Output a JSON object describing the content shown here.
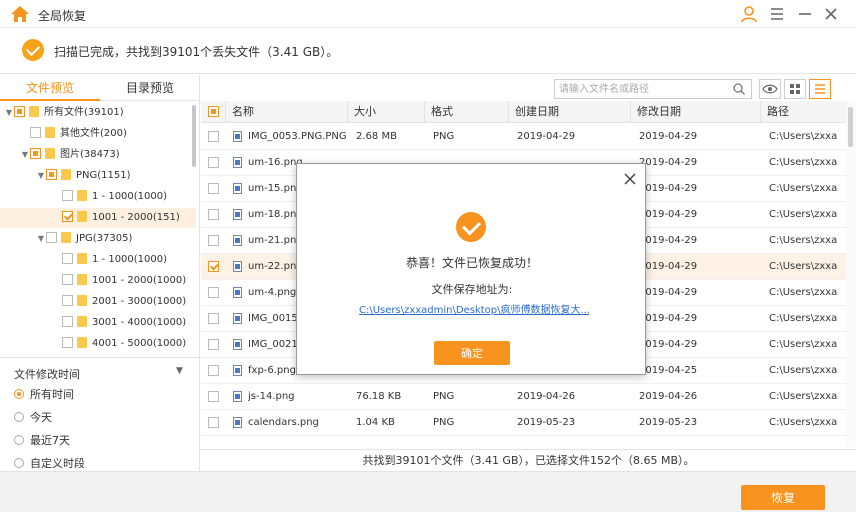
{
  "titlebar": {
    "title": "全局恢复"
  },
  "status": {
    "text": "扫描已完成，共找到39101个丢失文件（3.41 GB）。"
  },
  "sidebar": {
    "tabs": [
      {
        "label": "文件预览",
        "active": true
      },
      {
        "label": "目录预览",
        "active": false
      }
    ],
    "tree": [
      {
        "label": "所有文件(39101)"
      },
      {
        "label": "其他文件(200)"
      },
      {
        "label": "图片(38473)"
      },
      {
        "label": "PNG(1151)"
      },
      {
        "label": "1 - 1000(1000)"
      },
      {
        "label": "1001 - 2000(151)"
      },
      {
        "label": "JPG(37305)"
      },
      {
        "label": "1 - 1000(1000)"
      },
      {
        "label": "1001 - 2000(1000)"
      },
      {
        "label": "2001 - 3000(1000)"
      },
      {
        "label": "3001 - 4000(1000)"
      },
      {
        "label": "4001 - 5000(1000)"
      }
    ],
    "filter": {
      "title": "文件修改时间",
      "options": [
        {
          "label": "所有时间",
          "selected": true
        },
        {
          "label": "今天",
          "selected": false
        },
        {
          "label": "最近7天",
          "selected": false
        },
        {
          "label": "自定义时段",
          "selected": false
        }
      ]
    }
  },
  "toolbar": {
    "search_placeholder": "请输入文件名或路径"
  },
  "table": {
    "columns": [
      "名称",
      "大小",
      "格式",
      "创建日期",
      "修改日期",
      "路径"
    ],
    "rows": [
      {
        "name": "IMG_0053.PNG.PNG",
        "size": "2.68 MB",
        "format": "PNG",
        "created": "2019-04-29",
        "modified": "2019-04-29",
        "path": "C:\\Users\\zxxa",
        "checked": false
      },
      {
        "name": "um-16.png",
        "size": "",
        "format": "",
        "created": "",
        "modified": "2019-04-29",
        "path": "C:\\Users\\zxxa",
        "checked": false
      },
      {
        "name": "um-15.png",
        "size": "",
        "format": "",
        "created": "",
        "modified": "2019-04-29",
        "path": "C:\\Users\\zxxa",
        "checked": false
      },
      {
        "name": "um-18.png",
        "size": "",
        "format": "",
        "created": "",
        "modified": "2019-04-29",
        "path": "C:\\Users\\zxxa",
        "checked": false
      },
      {
        "name": "um-21.png",
        "size": "",
        "format": "",
        "created": "",
        "modified": "2019-04-29",
        "path": "C:\\Users\\zxxa",
        "checked": false
      },
      {
        "name": "um-22.png",
        "size": "",
        "format": "",
        "created": "",
        "modified": "2019-04-29",
        "path": "C:\\Users\\zxxa",
        "checked": true
      },
      {
        "name": "um-4.png",
        "size": "",
        "format": "",
        "created": "",
        "modified": "2019-04-29",
        "path": "C:\\Users\\zxxa",
        "checked": false
      },
      {
        "name": "IMG_0015",
        "size": "",
        "format": "",
        "created": "",
        "modified": "2019-04-29",
        "path": "C:\\Users\\zxxa",
        "checked": false
      },
      {
        "name": "IMG_0021",
        "size": "",
        "format": "",
        "created": "",
        "modified": "2019-04-29",
        "path": "C:\\Users\\zxxa",
        "checked": false
      },
      {
        "name": "fxp-6.png",
        "size": "31.77 KB",
        "format": "PNG",
        "created": "2019-04-25",
        "modified": "2019-04-25",
        "path": "C:\\Users\\zxxa",
        "checked": false
      },
      {
        "name": "js-14.png",
        "size": "76.18 KB",
        "format": "PNG",
        "created": "2019-04-26",
        "modified": "2019-04-26",
        "path": "C:\\Users\\zxxa",
        "checked": false
      },
      {
        "name": "calendars.png",
        "size": "1.04 KB",
        "format": "PNG",
        "created": "2019-05-23",
        "modified": "2019-05-23",
        "path": "C:\\Users\\zxxa",
        "checked": false
      }
    ],
    "summary": "共找到39101个文件（3.41 GB），已选择文件152个（8.65 MB）。"
  },
  "footer": {
    "recover_label": "恢复"
  },
  "modal": {
    "message": "恭喜！文件已恢复成功！",
    "save_label": "文件保存地址为:",
    "save_path": "C:\\Users\\zxxadmin\\Desktop\\疯师傅数据恢复大...",
    "ok_label": "确定"
  },
  "colors": {
    "accent": "#f7931e",
    "link": "#2b6bd1"
  }
}
